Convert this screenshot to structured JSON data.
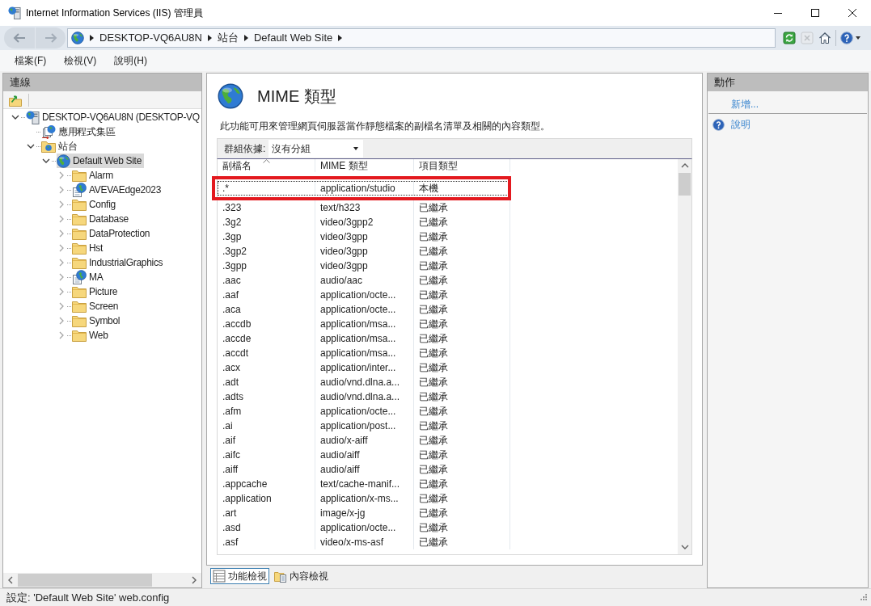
{
  "window": {
    "title": "Internet Information Services (IIS) 管理員"
  },
  "address_bar": {
    "breadcrumb": [
      "DESKTOP-VQ6AU8N",
      "站台",
      "Default Web Site"
    ]
  },
  "toolbar_buttons": [
    {
      "kind": "refresh",
      "disabled": false
    },
    {
      "kind": "stop",
      "disabled": true
    },
    {
      "kind": "home",
      "disabled": false
    },
    {
      "kind": "help",
      "disabled": false
    }
  ],
  "menu": [
    "檔案(F)",
    "檢視(V)",
    "說明(H)"
  ],
  "connections": {
    "title": "連線",
    "tree": [
      {
        "label": "DESKTOP-VQ6AU8N (DESKTOP-VQ",
        "kind": "server",
        "expanded": true,
        "selected": false,
        "children": [
          {
            "label": "應用程式集區",
            "kind": "pool",
            "selected": false
          },
          {
            "label": "站台",
            "kind": "sites",
            "expanded": true,
            "selected": false,
            "children": [
              {
                "label": "Default Web Site",
                "kind": "site",
                "expanded": true,
                "selected": true,
                "children": [
                  {
                    "label": "Alarm",
                    "kind": "folder",
                    "expanded": false,
                    "selected": false
                  },
                  {
                    "label": "AVEVAEdge2023",
                    "kind": "application",
                    "expanded": false,
                    "selected": false
                  },
                  {
                    "label": "Config",
                    "kind": "folder",
                    "expanded": false,
                    "selected": false
                  },
                  {
                    "label": "Database",
                    "kind": "folder",
                    "expanded": false,
                    "selected": false
                  },
                  {
                    "label": "DataProtection",
                    "kind": "folder",
                    "expanded": false,
                    "selected": false
                  },
                  {
                    "label": "Hst",
                    "kind": "folder",
                    "expanded": false,
                    "selected": false
                  },
                  {
                    "label": "IndustrialGraphics",
                    "kind": "folder",
                    "expanded": false,
                    "selected": false
                  },
                  {
                    "label": "MA",
                    "kind": "application",
                    "expanded": false,
                    "selected": false
                  },
                  {
                    "label": "Picture",
                    "kind": "folder",
                    "expanded": false,
                    "selected": false
                  },
                  {
                    "label": "Screen",
                    "kind": "folder",
                    "expanded": false,
                    "selected": false
                  },
                  {
                    "label": "Symbol",
                    "kind": "folder",
                    "expanded": false,
                    "selected": false
                  },
                  {
                    "label": "Web",
                    "kind": "folder",
                    "expanded": false,
                    "selected": false
                  }
                ]
              }
            ]
          }
        ]
      }
    ]
  },
  "feature": {
    "title": "MIME 類型",
    "description": "此功能可用來管理網頁伺服器當作靜態檔案的副檔名清單及相關的內容類型。",
    "group_by": {
      "label": "群組依據:",
      "value": "沒有分組"
    },
    "table": {
      "columns": [
        {
          "label": "副檔名",
          "sorted": true
        },
        {
          "label": "MIME 類型",
          "sorted": false
        },
        {
          "label": "項目類型",
          "sorted": false
        }
      ],
      "rows": [
        {
          "extension": ".*",
          "mime_type": "application/studio",
          "entry_type": "本機",
          "selected": true,
          "highlighted": true
        },
        {
          "extension": ".323",
          "mime_type": "text/h323",
          "entry_type": "已繼承",
          "selected": false,
          "highlighted": false
        },
        {
          "extension": ".3g2",
          "mime_type": "video/3gpp2",
          "entry_type": "已繼承",
          "selected": false,
          "highlighted": false
        },
        {
          "extension": ".3gp",
          "mime_type": "video/3gpp",
          "entry_type": "已繼承",
          "selected": false,
          "highlighted": false
        },
        {
          "extension": ".3gp2",
          "mime_type": "video/3gpp",
          "entry_type": "已繼承",
          "selected": false,
          "highlighted": false
        },
        {
          "extension": ".3gpp",
          "mime_type": "video/3gpp",
          "entry_type": "已繼承",
          "selected": false,
          "highlighted": false
        },
        {
          "extension": ".aac",
          "mime_type": "audio/aac",
          "entry_type": "已繼承",
          "selected": false,
          "highlighted": false
        },
        {
          "extension": ".aaf",
          "mime_type": "application/octe...",
          "entry_type": "已繼承",
          "selected": false,
          "highlighted": false
        },
        {
          "extension": ".aca",
          "mime_type": "application/octe...",
          "entry_type": "已繼承",
          "selected": false,
          "highlighted": false
        },
        {
          "extension": ".accdb",
          "mime_type": "application/msa...",
          "entry_type": "已繼承",
          "selected": false,
          "highlighted": false
        },
        {
          "extension": ".accde",
          "mime_type": "application/msa...",
          "entry_type": "已繼承",
          "selected": false,
          "highlighted": false
        },
        {
          "extension": ".accdt",
          "mime_type": "application/msa...",
          "entry_type": "已繼承",
          "selected": false,
          "highlighted": false
        },
        {
          "extension": ".acx",
          "mime_type": "application/inter...",
          "entry_type": "已繼承",
          "selected": false,
          "highlighted": false
        },
        {
          "extension": ".adt",
          "mime_type": "audio/vnd.dlna.a...",
          "entry_type": "已繼承",
          "selected": false,
          "highlighted": false
        },
        {
          "extension": ".adts",
          "mime_type": "audio/vnd.dlna.a...",
          "entry_type": "已繼承",
          "selected": false,
          "highlighted": false
        },
        {
          "extension": ".afm",
          "mime_type": "application/octe...",
          "entry_type": "已繼承",
          "selected": false,
          "highlighted": false
        },
        {
          "extension": ".ai",
          "mime_type": "application/post...",
          "entry_type": "已繼承",
          "selected": false,
          "highlighted": false
        },
        {
          "extension": ".aif",
          "mime_type": "audio/x-aiff",
          "entry_type": "已繼承",
          "selected": false,
          "highlighted": false
        },
        {
          "extension": ".aifc",
          "mime_type": "audio/aiff",
          "entry_type": "已繼承",
          "selected": false,
          "highlighted": false
        },
        {
          "extension": ".aiff",
          "mime_type": "audio/aiff",
          "entry_type": "已繼承",
          "selected": false,
          "highlighted": false
        },
        {
          "extension": ".appcache",
          "mime_type": "text/cache-manif...",
          "entry_type": "已繼承",
          "selected": false,
          "highlighted": false
        },
        {
          "extension": ".application",
          "mime_type": "application/x-ms...",
          "entry_type": "已繼承",
          "selected": false,
          "highlighted": false
        },
        {
          "extension": ".art",
          "mime_type": "image/x-jg",
          "entry_type": "已繼承",
          "selected": false,
          "highlighted": false
        },
        {
          "extension": ".asd",
          "mime_type": "application/octe...",
          "entry_type": "已繼承",
          "selected": false,
          "highlighted": false
        },
        {
          "extension": ".asf",
          "mime_type": "video/x-ms-asf",
          "entry_type": "已繼承",
          "selected": false,
          "highlighted": false
        }
      ]
    }
  },
  "view_tabs": [
    {
      "label": "功能檢視",
      "selected": true
    },
    {
      "label": "內容檢視",
      "selected": false
    }
  ],
  "actions": {
    "title": "動作",
    "items": [
      {
        "kind": "link",
        "label": "新增..."
      },
      {
        "kind": "separator"
      },
      {
        "kind": "help",
        "label": "說明"
      }
    ]
  },
  "status_bar": "設定: 'Default Web Site' web.config"
}
